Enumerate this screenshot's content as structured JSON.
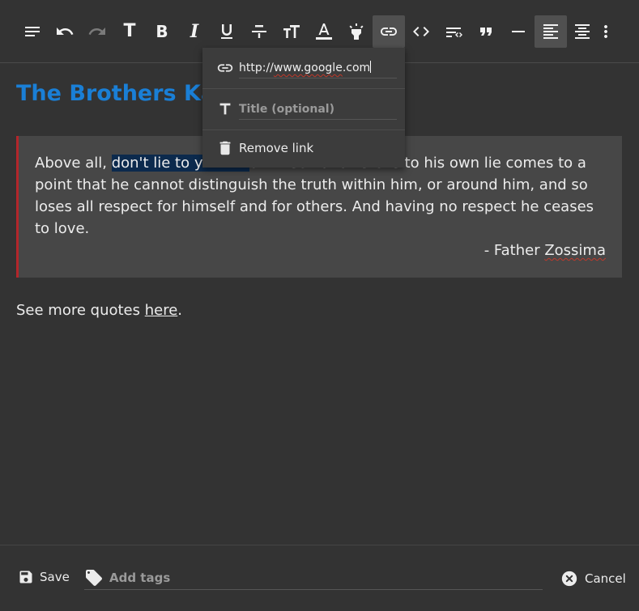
{
  "toolbar": {
    "icons": [
      "paragraph-icon",
      "undo-icon",
      "redo-icon",
      "heading-icon",
      "bold-icon",
      "italic-icon",
      "underline-icon",
      "strikethrough-icon",
      "font-size-icon",
      "text-color-icon",
      "highlight-icon",
      "link-icon",
      "inline-code-icon",
      "code-block-icon",
      "quote-icon",
      "horizontal-rule-icon",
      "align-left-icon",
      "align-center-icon",
      "more-icon"
    ],
    "glyph_bold": "B",
    "glyph_italic": "I",
    "glyph_heading": "T",
    "glyph_text_color": "A"
  },
  "link_popup": {
    "url_value": "http://www.google.com",
    "url_prefix": "http://",
    "url_misspelled": "www.google",
    "url_suffix": ".com",
    "title_placeholder": "Title (optional)",
    "remove_label": "Remove link"
  },
  "document": {
    "title": "The Brothers Ka",
    "quote_before": "Above all, ",
    "quote_highlight": "don't lie to y          ",
    "quote_after": "o himself and listens to his own lie comes to a point that he cannot distinguish the truth within him, or around him, and so loses all respect for himself and for others. And having no respect he ceases to love.",
    "author_prefix": "- Father ",
    "author_name": "Zossima",
    "more_text": "See more quotes ",
    "more_link": "here",
    "more_end": "."
  },
  "footer": {
    "save_label": "Save",
    "tags_placeholder": "Add tags",
    "cancel_label": "Cancel"
  },
  "colors": {
    "background": "#333333",
    "title": "#1a7fd6",
    "quote_border": "#b3262b",
    "selection": "#0c2a4d"
  }
}
